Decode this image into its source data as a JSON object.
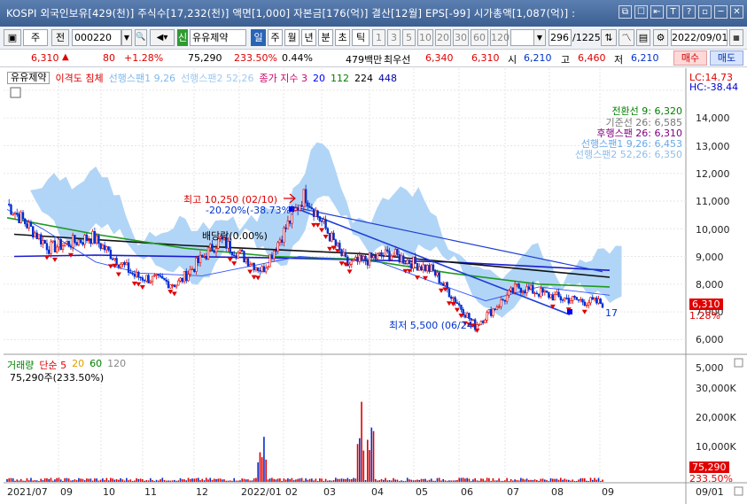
{
  "title_bar": {
    "text": "KOSPI 외국인보유[429(천)] 주식수[17,232(천)] 액면[1,000] 자본금[176(억)] 결산[12월] EPS[-99] 시가총액[1,087(억)] :",
    "buttons": [
      "⧉",
      "☐",
      "⇤",
      "T",
      "?",
      "▫",
      "─",
      "✕"
    ]
  },
  "toolbar": {
    "market_sel": "주",
    "all_label": "전",
    "code": "000220",
    "sound_icon": "speaker-icon",
    "new_badge": "신",
    "stock_name": "유유제약",
    "periods": [
      "일",
      "주",
      "월",
      "년",
      "분",
      "초",
      "틱"
    ],
    "active_period": "일",
    "intervals": [
      "1",
      "3",
      "5",
      "10",
      "20",
      "30",
      "60",
      "120"
    ],
    "count": "296",
    "total": "/1225",
    "date": "2022/09/01"
  },
  "quote": {
    "price": "6,310",
    "arrow": "▲",
    "change": "80",
    "change_pct": "+1.28%",
    "volume": "75,290",
    "volume_pct": "233.50%",
    "turnover": "0.44%",
    "amount": "479백만",
    "ask_label": "최우선",
    "ask": "6,340",
    "bid": "6,310",
    "open_label": "시",
    "open": "6,210",
    "high_label": "고",
    "high": "6,460",
    "low_label": "저",
    "low": "6,210",
    "buy_label": "매수",
    "sell_label": "매도"
  },
  "legend": {
    "name": "유유제약",
    "items": [
      {
        "text": "이격도 침체",
        "color": "#e00000"
      },
      {
        "text": "선행스팬1 9,26",
        "color": "#7fb8ee"
      },
      {
        "text": "선행스팬2 52,26",
        "color": "#9ec9f2"
      },
      {
        "text": "종가 지수 3",
        "color": "#d0006a"
      },
      {
        "text": "20",
        "color": "#0000ff"
      },
      {
        "text": "112",
        "color": "#008000"
      },
      {
        "text": "224",
        "color": "#000000"
      },
      {
        "text": "448",
        "color": "#0000aa"
      }
    ],
    "lc": "LC:14.73",
    "hc": "HC:-38.44"
  },
  "ichimoku_labels": [
    {
      "text": "전환선 9: 6,320",
      "color": "#008000"
    },
    {
      "text": "기준선 26: 6,585",
      "color": "#777777"
    },
    {
      "text": "후행스팬 26: 6,310",
      "color": "#800080"
    },
    {
      "text": "선행스팬1 9,26: 6,453",
      "color": "#6aa8e8"
    },
    {
      "text": "선행스팬2 52,26: 6,350",
      "color": "#8fbde9"
    }
  ],
  "annotations": {
    "high": "최고 10,250 (02/10)",
    "high_change": "-20.20%(-38.73%)",
    "mid": "배당락(0.00%)",
    "low": "최저 5,500 (06/24)",
    "last_mark": "17"
  },
  "price_axis": [
    "14,000",
    "13,000",
    "12,000",
    "11,000",
    "10,000",
    "9,000",
    "8,000",
    "7,000",
    "6,000",
    "5,000"
  ],
  "price_tag": {
    "price": "6,310",
    "pct": "1.28%",
    "color": "#e00000"
  },
  "volume_legend": {
    "title": "거래량",
    "items": [
      {
        "text": "단순 5",
        "color": "#e00000"
      },
      {
        "text": "20",
        "color": "#e0a000"
      },
      {
        "text": "60",
        "color": "#008000"
      },
      {
        "text": "120",
        "color": "#888888"
      }
    ],
    "current": "75,290주(233.50%)"
  },
  "volume_axis": [
    "30,000K",
    "20,000K",
    "10,000K"
  ],
  "volume_tag": {
    "value": "75,290",
    "pct": "233.50%"
  },
  "date_axis": [
    "2021/07",
    "09",
    "10",
    "11",
    "12",
    "2022/01",
    "02",
    "03",
    "04",
    "05",
    "06",
    "07",
    "08",
    "09"
  ],
  "date_axis_right": "09/01",
  "chart_data": {
    "type": "candlestick",
    "x_range": [
      "2021/07",
      "2022/09/01"
    ],
    "price_range": [
      4500,
      14700
    ],
    "price_series": [
      [
        "2021/07",
        9900
      ],
      [
        "2021/08",
        8300
      ],
      [
        "2021/09",
        8700
      ],
      [
        "2021/10",
        7300
      ],
      [
        "2021/11",
        7000
      ],
      [
        "2021/12",
        8600
      ],
      [
        "2022/01",
        7500
      ],
      [
        "2022/02",
        10250
      ],
      [
        "2022/03",
        7700
      ],
      [
        "2022/04",
        8100
      ],
      [
        "2022/05",
        7500
      ],
      [
        "2022/06",
        5500
      ],
      [
        "2022/07",
        6900
      ],
      [
        "2022/08",
        6500
      ],
      [
        "2022/09",
        6310
      ]
    ],
    "ma20": [
      [
        0,
        9700
      ],
      [
        40,
        9000
      ],
      [
        100,
        7800
      ],
      [
        150,
        7400
      ],
      [
        220,
        7300
      ],
      [
        330,
        8000
      ],
      [
        420,
        7800
      ],
      [
        470,
        7200
      ],
      [
        540,
        6400
      ],
      [
        600,
        6900
      ],
      [
        680,
        6600
      ]
    ],
    "ma112": [
      [
        0,
        9400
      ],
      [
        100,
        8800
      ],
      [
        200,
        8300
      ],
      [
        300,
        8000
      ],
      [
        400,
        7900
      ],
      [
        500,
        7400
      ],
      [
        600,
        7000
      ],
      [
        680,
        6900
      ]
    ],
    "ma224": [
      [
        8,
        8800
      ],
      [
        200,
        8400
      ],
      [
        400,
        8100
      ],
      [
        680,
        7250
      ]
    ],
    "ma448": [
      [
        8,
        8000
      ],
      [
        100,
        8050
      ],
      [
        300,
        7950
      ],
      [
        500,
        7800
      ],
      [
        680,
        7500
      ]
    ],
    "trend_line": [
      [
        "2022/02",
        9800
      ],
      [
        "2022/08",
        5900
      ]
    ],
    "volume_peaks_k": [
      [
        "2021/12",
        17000
      ],
      [
        "2022/02",
        37000
      ],
      [
        "2022/02b",
        25000
      ]
    ]
  }
}
